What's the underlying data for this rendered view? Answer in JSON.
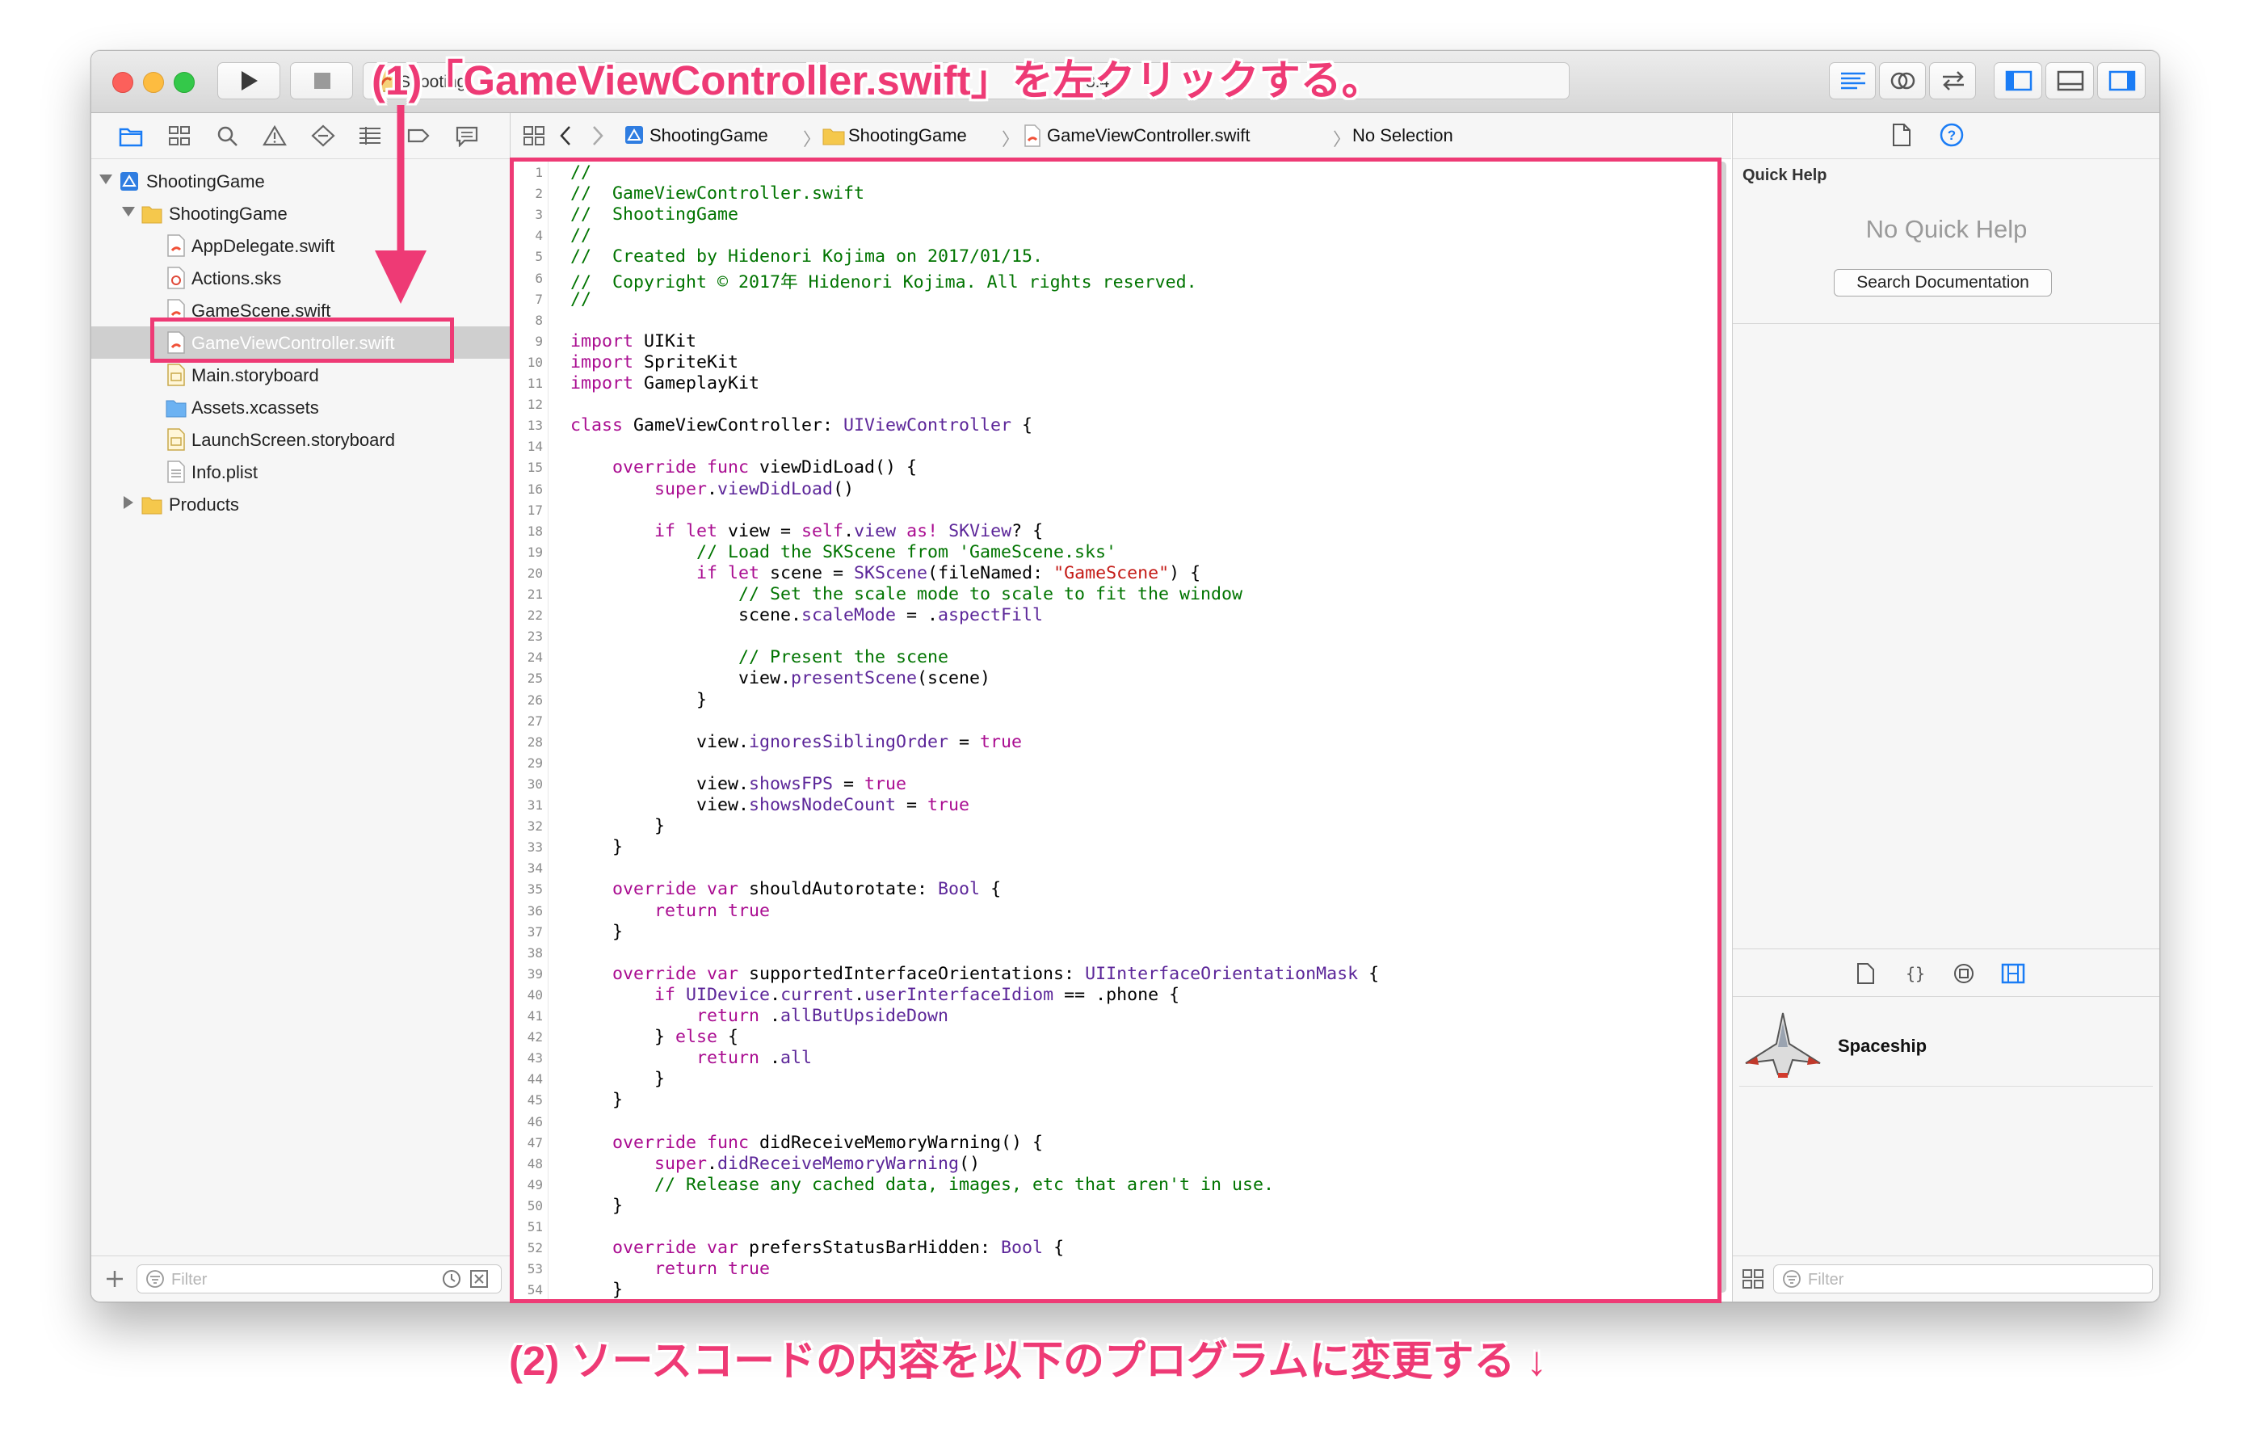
{
  "annotations": {
    "step1": "(1)「GameViewController.swift」を左クリックする。",
    "step2": "(2) ソースコードの内容を以下のプログラムに変更する ↓"
  },
  "toolbar": {
    "activity_left": "S",
    "activity_fragment": "ooting",
    "activity_right": "8:4"
  },
  "navigator": {
    "tree": [
      {
        "label": "ShootingGame",
        "icon": "project-icon",
        "level": 0,
        "expanded": true
      },
      {
        "label": "ShootingGame",
        "icon": "folder-icon",
        "level": 1,
        "expanded": true
      },
      {
        "label": "AppDelegate.swift",
        "icon": "swift-file-icon",
        "level": 2
      },
      {
        "label": "Actions.sks",
        "icon": "sks-file-icon",
        "level": 2
      },
      {
        "label": "GameScene.swift",
        "icon": "swift-file-icon",
        "level": 2
      },
      {
        "label": "GameViewController.swift",
        "icon": "swift-file-icon",
        "level": 2,
        "selected": true
      },
      {
        "label": "Main.storyboard",
        "icon": "storyboard-icon",
        "level": 2
      },
      {
        "label": "Assets.xcassets",
        "icon": "assets-folder-icon",
        "level": 2
      },
      {
        "label": "LaunchScreen.storyboard",
        "icon": "storyboard-icon",
        "level": 2
      },
      {
        "label": "Info.plist",
        "icon": "plist-icon",
        "level": 2
      },
      {
        "label": "Products",
        "icon": "folder-icon",
        "level": 1,
        "expanded": false
      }
    ],
    "filter_placeholder": "Filter"
  },
  "jumpbar": {
    "items": [
      "ShootingGame",
      "ShootingGame",
      "GameViewController.swift",
      "No Selection"
    ]
  },
  "editor": {
    "lines": [
      [
        [
          "c",
          "//"
        ]
      ],
      [
        [
          "c",
          "//  GameViewController.swift"
        ]
      ],
      [
        [
          "c",
          "//  ShootingGame"
        ]
      ],
      [
        [
          "c",
          "//"
        ]
      ],
      [
        [
          "c",
          "//  Created by Hidenori Kojima on 2017/01/15."
        ]
      ],
      [
        [
          "c",
          "//  Copyright © 2017年 Hidenori Kojima. All rights reserved."
        ]
      ],
      [
        [
          "c",
          "//"
        ]
      ],
      [],
      [
        [
          "k",
          "import"
        ],
        [
          "n",
          " UIKit"
        ]
      ],
      [
        [
          "k",
          "import"
        ],
        [
          "n",
          " SpriteKit"
        ]
      ],
      [
        [
          "k",
          "import"
        ],
        [
          "n",
          " GameplayKit"
        ]
      ],
      [],
      [
        [
          "k",
          "class"
        ],
        [
          "n",
          " GameViewController: "
        ],
        [
          "t",
          "UIViewController"
        ],
        [
          "n",
          " {"
        ]
      ],
      [],
      [
        [
          "n",
          "    "
        ],
        [
          "k",
          "override func"
        ],
        [
          "n",
          " viewDidLoad() {"
        ]
      ],
      [
        [
          "n",
          "        "
        ],
        [
          "k",
          "super"
        ],
        [
          "n",
          "."
        ],
        [
          "t",
          "viewDidLoad"
        ],
        [
          "n",
          "()"
        ]
      ],
      [],
      [
        [
          "n",
          "        "
        ],
        [
          "k",
          "if let"
        ],
        [
          "n",
          " view = "
        ],
        [
          "k",
          "self"
        ],
        [
          "n",
          "."
        ],
        [
          "t",
          "view"
        ],
        [
          "n",
          " "
        ],
        [
          "k",
          "as!"
        ],
        [
          "n",
          " "
        ],
        [
          "t",
          "SKView"
        ],
        [
          "n",
          "? {"
        ]
      ],
      [
        [
          "n",
          "            "
        ],
        [
          "c",
          "// Load the SKScene from 'GameScene.sks'"
        ]
      ],
      [
        [
          "n",
          "            "
        ],
        [
          "k",
          "if let"
        ],
        [
          "n",
          " scene = "
        ],
        [
          "t",
          "SKScene"
        ],
        [
          "n",
          "(fileNamed: "
        ],
        [
          "s",
          "\"GameScene\""
        ],
        [
          "n",
          ") {"
        ]
      ],
      [
        [
          "n",
          "                "
        ],
        [
          "c",
          "// Set the scale mode to scale to fit the window"
        ]
      ],
      [
        [
          "n",
          "                scene."
        ],
        [
          "t",
          "scaleMode"
        ],
        [
          "n",
          " = ."
        ],
        [
          "t",
          "aspectFill"
        ]
      ],
      [],
      [
        [
          "n",
          "                "
        ],
        [
          "c",
          "// Present the scene"
        ]
      ],
      [
        [
          "n",
          "                view."
        ],
        [
          "t",
          "presentScene"
        ],
        [
          "n",
          "(scene)"
        ]
      ],
      [
        [
          "n",
          "            }"
        ]
      ],
      [],
      [
        [
          "n",
          "            view."
        ],
        [
          "t",
          "ignoresSiblingOrder"
        ],
        [
          "n",
          " = "
        ],
        [
          "k",
          "true"
        ]
      ],
      [],
      [
        [
          "n",
          "            view."
        ],
        [
          "t",
          "showsFPS"
        ],
        [
          "n",
          " = "
        ],
        [
          "k",
          "true"
        ]
      ],
      [
        [
          "n",
          "            view."
        ],
        [
          "t",
          "showsNodeCount"
        ],
        [
          "n",
          " = "
        ],
        [
          "k",
          "true"
        ]
      ],
      [
        [
          "n",
          "        }"
        ]
      ],
      [
        [
          "n",
          "    }"
        ]
      ],
      [],
      [
        [
          "n",
          "    "
        ],
        [
          "k",
          "override var"
        ],
        [
          "n",
          " shouldAutorotate: "
        ],
        [
          "t",
          "Bool"
        ],
        [
          "n",
          " {"
        ]
      ],
      [
        [
          "n",
          "        "
        ],
        [
          "k",
          "return true"
        ]
      ],
      [
        [
          "n",
          "    }"
        ]
      ],
      [],
      [
        [
          "n",
          "    "
        ],
        [
          "k",
          "override var"
        ],
        [
          "n",
          " supportedInterfaceOrientations: "
        ],
        [
          "t",
          "UIInterfaceOrientationMask"
        ],
        [
          "n",
          " {"
        ]
      ],
      [
        [
          "n",
          "        "
        ],
        [
          "k",
          "if"
        ],
        [
          "n",
          " "
        ],
        [
          "t",
          "UIDevice"
        ],
        [
          "n",
          "."
        ],
        [
          "t",
          "current"
        ],
        [
          "n",
          "."
        ],
        [
          "t",
          "userInterfaceIdiom"
        ],
        [
          "n",
          " == .phone {"
        ]
      ],
      [
        [
          "n",
          "            "
        ],
        [
          "k",
          "return"
        ],
        [
          "n",
          " ."
        ],
        [
          "t",
          "allButUpsideDown"
        ]
      ],
      [
        [
          "n",
          "        } "
        ],
        [
          "k",
          "else"
        ],
        [
          "n",
          " {"
        ]
      ],
      [
        [
          "n",
          "            "
        ],
        [
          "k",
          "return"
        ],
        [
          "n",
          " ."
        ],
        [
          "t",
          "all"
        ]
      ],
      [
        [
          "n",
          "        }"
        ]
      ],
      [
        [
          "n",
          "    }"
        ]
      ],
      [],
      [
        [
          "n",
          "    "
        ],
        [
          "k",
          "override func"
        ],
        [
          "n",
          " didReceiveMemoryWarning() {"
        ]
      ],
      [
        [
          "n",
          "        "
        ],
        [
          "k",
          "super"
        ],
        [
          "n",
          "."
        ],
        [
          "t",
          "didReceiveMemoryWarning"
        ],
        [
          "n",
          "()"
        ]
      ],
      [
        [
          "n",
          "        "
        ],
        [
          "c",
          "// Release any cached data, images, etc that aren't in use."
        ]
      ],
      [
        [
          "n",
          "    }"
        ]
      ],
      [],
      [
        [
          "n",
          "    "
        ],
        [
          "k",
          "override var"
        ],
        [
          "n",
          " prefersStatusBarHidden: "
        ],
        [
          "t",
          "Bool"
        ],
        [
          "n",
          " {"
        ]
      ],
      [
        [
          "n",
          "        "
        ],
        [
          "k",
          "return true"
        ]
      ],
      [
        [
          "n",
          "    }"
        ]
      ]
    ]
  },
  "inspector": {
    "section_title": "Quick Help",
    "empty_text": "No Quick Help",
    "search_button": "Search Documentation",
    "library_item": "Spaceship",
    "filter_placeholder": "Filter"
  },
  "colors": {
    "annotation": "#ee3a75",
    "keyword": "#aa0d91",
    "comment": "#007400",
    "type": "#5c2699",
    "string": "#c41a16",
    "accent": "#1a7cf5"
  }
}
